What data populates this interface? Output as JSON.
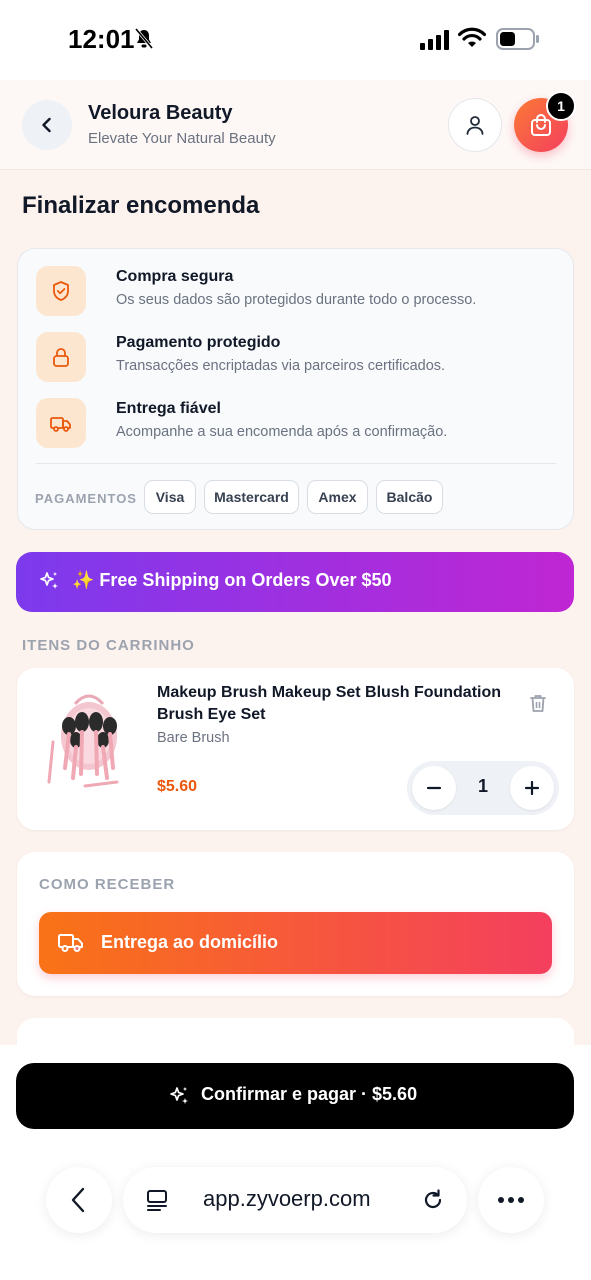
{
  "status_bar": {
    "time": "12:01"
  },
  "header": {
    "brand_name": "Veloura Beauty",
    "tagline": "Elevate Your Natural Beauty",
    "cart_count": "1"
  },
  "page_title": "Finalizar encomenda",
  "trust": {
    "items": [
      {
        "title": "Compra segura",
        "desc": "Os seus dados são protegidos durante todo o processo.",
        "icon": "shield-icon"
      },
      {
        "title": "Pagamento protegido",
        "desc": "Transacções encriptadas via parceiros certificados.",
        "icon": "lock-icon"
      },
      {
        "title": "Entrega fiável",
        "desc": "Acompanhe a sua encomenda após a confirmação.",
        "icon": "truck-icon"
      }
    ],
    "payments_label": "PAGAMENTOS",
    "payment_methods": [
      "Visa",
      "Mastercard",
      "Amex",
      "Balcão"
    ]
  },
  "promo": {
    "text": "✨ Free Shipping on Orders Over $50"
  },
  "cart": {
    "section_label": "ITENS DO CARRINHO",
    "item": {
      "name": "Makeup Brush Makeup Set Blush Foundation Brush Eye Set",
      "brand": "Bare Brush",
      "price": "$5.60",
      "quantity": "1"
    }
  },
  "delivery": {
    "section_label": "COMO RECEBER",
    "option": "Entrega ao domicílio"
  },
  "confirm": {
    "label": "Confirmar e pagar · $5.60"
  },
  "browser": {
    "url": "app.zyvoerp.com"
  },
  "colors": {
    "accent_orange": "#f97316",
    "accent_pink": "#f43f5e",
    "promo_start": "#7c3aed",
    "promo_end": "#c026d3",
    "price": "#ea580c"
  }
}
